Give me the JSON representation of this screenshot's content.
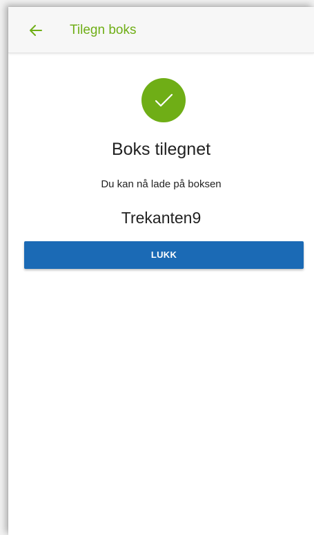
{
  "header": {
    "back_icon": "arrow-left-icon",
    "title": "Tilegn boks"
  },
  "confirmation": {
    "status_icon": "checkmark-circle-icon",
    "heading": "Boks tilegnet",
    "message": "Du kan nå lade på boksen",
    "box_name": "Trekanten9",
    "close_label": "LUKK"
  },
  "colors": {
    "accent": "#6fae16",
    "button": "#1b6ab5",
    "text": "#222222",
    "app_bar": "#f7f7f7"
  }
}
